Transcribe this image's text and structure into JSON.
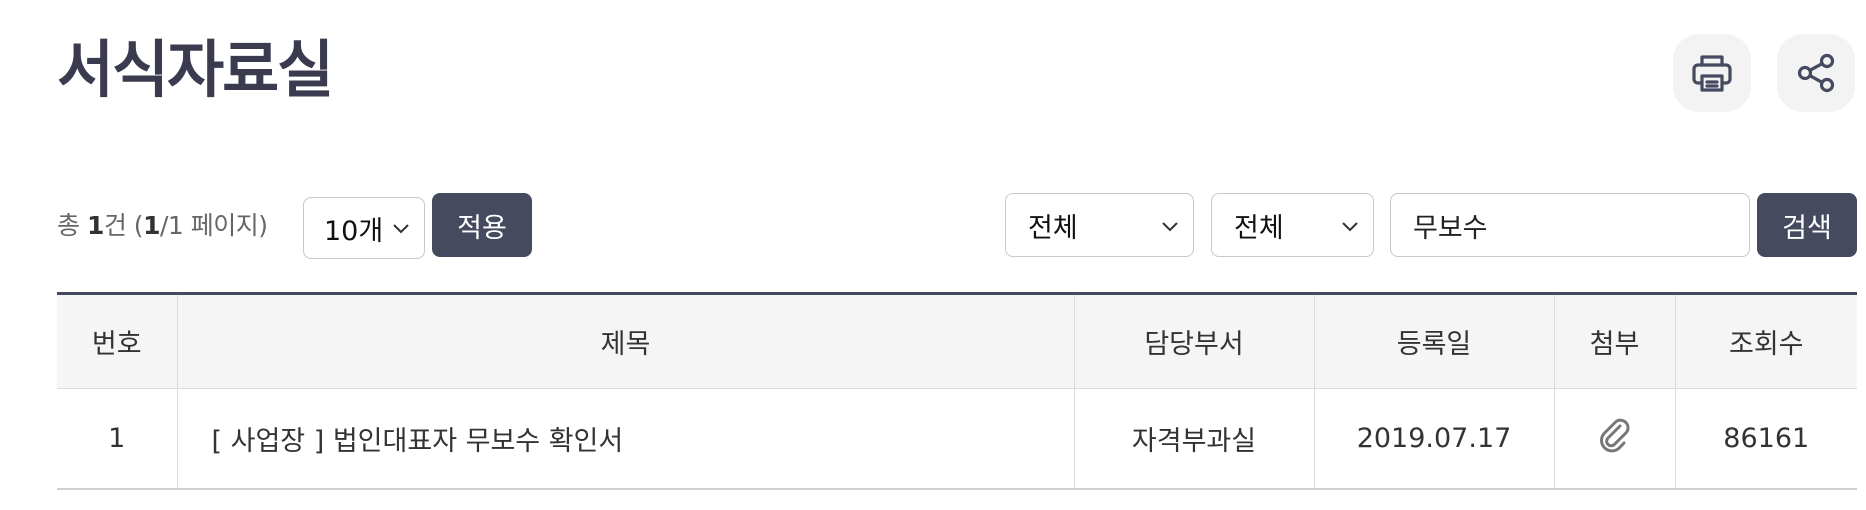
{
  "page": {
    "title": "서식자료실"
  },
  "actions": {
    "print_icon": "printer-icon",
    "share_icon": "share-icon"
  },
  "list_info": {
    "prefix": "총 ",
    "total": "1",
    "count_unit": "건 (",
    "current_page": "1",
    "slash": "/1 페이지)"
  },
  "page_size": {
    "selected": "10개",
    "apply_label": "적용"
  },
  "search": {
    "category1": "전체",
    "category2": "전체",
    "keyword": "무보수",
    "button_label": "검색"
  },
  "table": {
    "headers": [
      "번호",
      "제목",
      "담당부서",
      "등록일",
      "첨부",
      "조회수"
    ],
    "rows": [
      {
        "no": "1",
        "title": "[ 사업장 ] 법인대표자 무보수 확인서",
        "department": "자격부과실",
        "date": "2019.07.17",
        "attachment_icon": "paperclip-icon",
        "views": "86161"
      }
    ]
  }
}
